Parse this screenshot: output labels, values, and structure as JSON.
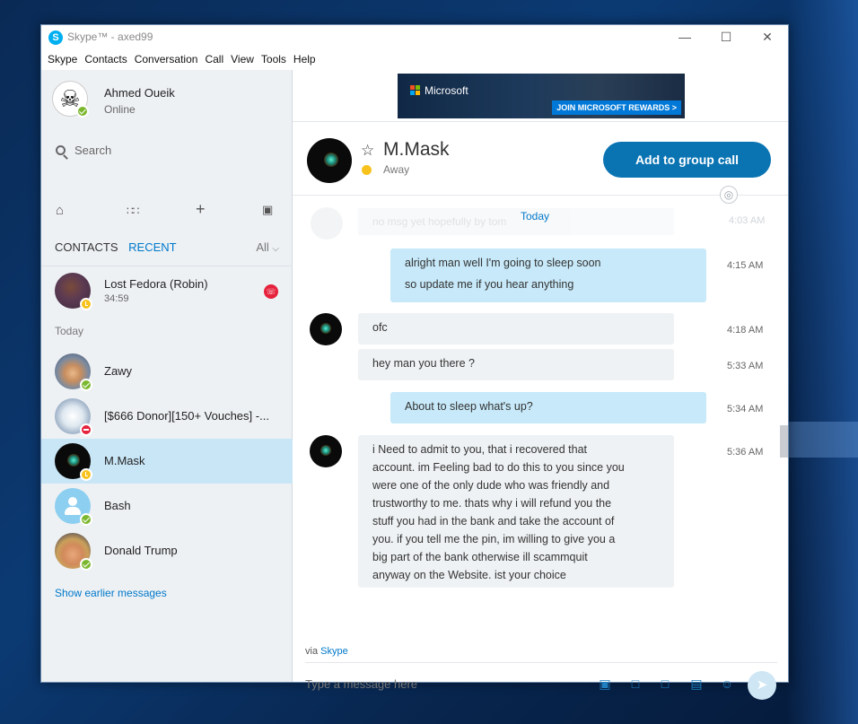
{
  "window": {
    "title": "Skype™ - axed99",
    "app_icon": "S"
  },
  "menu": [
    "Skype",
    "Contacts",
    "Conversation",
    "Call",
    "View",
    "Tools",
    "Help"
  ],
  "profile": {
    "name": "Ahmed Oueik",
    "status": "Online"
  },
  "search": {
    "placeholder": "Search"
  },
  "tabs": {
    "contacts": "CONTACTS",
    "recent": "RECENT",
    "filter": "All"
  },
  "recent": {
    "pinned": {
      "name": "Lost Fedora (Robin)",
      "duration": "34:59"
    },
    "today_label": "Today",
    "items": [
      {
        "name": "Zawy",
        "status": "online"
      },
      {
        "name": "[$666 Donor][150+ Vouches] -...",
        "status": "busy"
      },
      {
        "name": "M.Mask",
        "status": "away"
      },
      {
        "name": "Bash",
        "status": "online"
      },
      {
        "name": "Donald Trump",
        "status": "online"
      }
    ],
    "show_earlier": "Show earlier messages"
  },
  "ad": {
    "brand": "Microsoft",
    "cta": "JOIN MICROSOFT REWARDS >",
    "logo_colors": [
      "#f25022",
      "#7fba00",
      "#00a4ef",
      "#ffb900"
    ]
  },
  "conversation": {
    "contact_name": "M.Mask",
    "contact_status": "Away",
    "group_call_label": "Add to group call",
    "day_label": "Today",
    "ghost_text": "no msg yet hopefully by tom",
    "ghost_time": "4:03 AM",
    "messages": [
      {
        "direction": "out",
        "lines": [
          "alright man well I'm going to sleep soon",
          "so update me if you hear anything"
        ],
        "time": "4:15 AM"
      },
      {
        "direction": "in",
        "lines": [
          "ofc"
        ],
        "time": "4:18 AM"
      },
      {
        "direction": "in",
        "lines": [
          "hey man you there ?"
        ],
        "time": "5:33 AM"
      },
      {
        "direction": "out",
        "lines": [
          "About to sleep what's up?"
        ],
        "time": "5:34 AM"
      },
      {
        "direction": "in",
        "lines": [
          "i Need to admit to you, that i recovered that",
          "account. im Feeling bad to do this to you since you",
          "were one of the only dude who was friendly and",
          "trustworthy to me. thats why i will refund you the",
          "stuff you had in the bank and take the account of",
          "you. if you tell me the pin, im willing to give you a",
          "big part of the bank otherwise ill scammquit",
          "anyway on the Website. ist your choice"
        ],
        "time": "5:36 AM"
      }
    ],
    "via_prefix": "via",
    "via_link": "Skype",
    "compose_placeholder": "Type a message here"
  },
  "colors": {
    "accent": "#0078ca",
    "call_button": "#0a74b3",
    "selected_row": "#c9e6f7",
    "outgoing_bubble": "#c7e9f9",
    "incoming_bubble": "#eff2f4"
  }
}
